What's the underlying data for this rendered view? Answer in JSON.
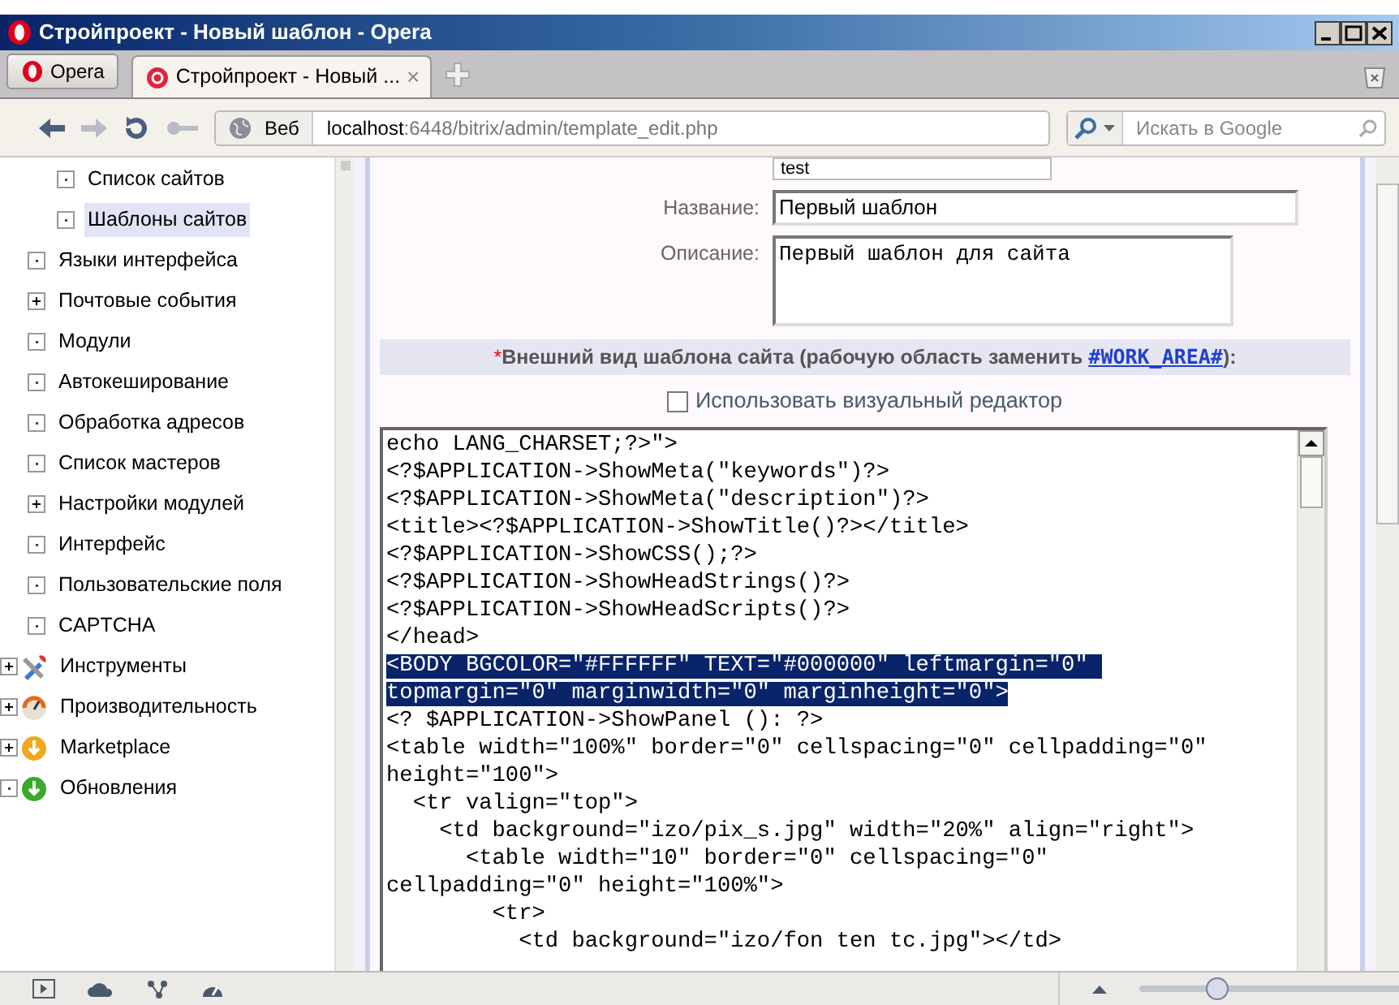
{
  "window": {
    "title": "Стройпроект - Новый шаблон - Opera"
  },
  "menu_button": {
    "label": "Opera"
  },
  "tabs": [
    {
      "label": "Стройпроект - Новый ...",
      "selected": true,
      "close": "×"
    }
  ],
  "address_bar": {
    "badge": "Веб",
    "host": "localhost",
    "path": ":6448/bitrix/admin/template_edit.php"
  },
  "search": {
    "placeholder": "Искать в Google"
  },
  "sidebar": {
    "tree": [
      {
        "children": [
          {
            "children": [
              {
                "label": "Список сайтов",
                "expandable": false,
                "selected": false
              },
              {
                "label": "Шаблоны сайтов",
                "expandable": false,
                "selected": true
              }
            ]
          },
          {
            "label": "Языки интерфейса",
            "expandable": false,
            "selected": false
          },
          {
            "label": "Почтовые события",
            "expandable": true,
            "selected": false
          },
          {
            "label": "Модули",
            "expandable": false,
            "selected": false
          },
          {
            "label": "Автокеширование",
            "expandable": false,
            "selected": false
          },
          {
            "label": "Обработка адресов",
            "expandable": false,
            "selected": false
          },
          {
            "label": "Список мастеров",
            "expandable": false,
            "selected": false
          },
          {
            "label": "Настройки модулей",
            "expandable": true,
            "selected": false
          },
          {
            "label": "Интерфейс",
            "expandable": false,
            "selected": false
          },
          {
            "label": "Пользовательские поля",
            "expandable": false,
            "selected": false
          },
          {
            "label": "CAPTCHA",
            "expandable": false,
            "selected": false
          }
        ]
      },
      {
        "label": "Инструменты",
        "kind": "tools",
        "expandable": true,
        "selected": false
      },
      {
        "label": "Производительность",
        "kind": "gauge",
        "expandable": true,
        "selected": false
      },
      {
        "label": "Marketplace",
        "kind": "market",
        "expandable": true,
        "selected": false
      },
      {
        "label": "Обновления",
        "kind": "update",
        "expandable": false,
        "selected": false
      }
    ]
  },
  "form": {
    "top_field": {
      "value": "test"
    },
    "fields": [
      {
        "label": "Название:",
        "kind": "input",
        "value": "Первый шаблон"
      },
      {
        "label": "Описание:",
        "kind": "textarea",
        "value": "Первый шаблон для сайта"
      }
    ],
    "section_header": {
      "mark": "*",
      "text": "Внешний вид шаблона сайта (рабочую область заменить ",
      "link": "#WORK_AREA#",
      "tail": "):"
    },
    "visual_editor": {
      "label": "Использовать визуальный редактор",
      "checked": false
    },
    "code_lines": [
      {
        "text": "echo LANG_CHARSET;?>\">",
        "selected": false
      },
      {
        "text": "<?$APPLICATION->ShowMeta(\"keywords\")?>",
        "selected": false
      },
      {
        "text": "<?$APPLICATION->ShowMeta(\"description\")?>",
        "selected": false
      },
      {
        "text": "<title><?$APPLICATION->ShowTitle()?></title>",
        "selected": false
      },
      {
        "text": "<?$APPLICATION->ShowCSS();?>",
        "selected": false
      },
      {
        "text": "<?$APPLICATION->ShowHeadStrings()?>",
        "selected": false
      },
      {
        "text": "<?$APPLICATION->ShowHeadScripts()?>",
        "selected": false
      },
      {
        "text": "</head>",
        "selected": false
      },
      {
        "text": "<BODY BGCOLOR=\"#FFFFFF\" TEXT=\"#000000\" leftmargin=\"0\" ",
        "selected": true
      },
      {
        "text": "topmargin=\"0\" marginwidth=\"0\" marginheight=\"0\">",
        "selected": true
      },
      {
        "text": "<? $APPLICATION->ShowPanel (): ?>",
        "selected": false
      },
      {
        "text": "<table width=\"100%\" border=\"0\" cellspacing=\"0\" cellpadding=\"0\"",
        "selected": false
      },
      {
        "text": "height=\"100\">",
        "selected": false
      },
      {
        "text": "  <tr valign=\"top\">",
        "selected": false
      },
      {
        "text": "    <td background=\"izo/pix_s.jpg\" width=\"20%\" align=\"right\">",
        "selected": false
      },
      {
        "text": "      <table width=\"10\" border=\"0\" cellspacing=\"0\"",
        "selected": false
      },
      {
        "text": "cellpadding=\"0\" height=\"100%\">",
        "selected": false
      },
      {
        "text": "        <tr>",
        "selected": false
      },
      {
        "text": "          <td background=\"izo/fon ten tc.jpg\"></td>",
        "selected": false
      }
    ]
  },
  "status_bar": {
    "zoom": {
      "level": 0.28
    }
  }
}
